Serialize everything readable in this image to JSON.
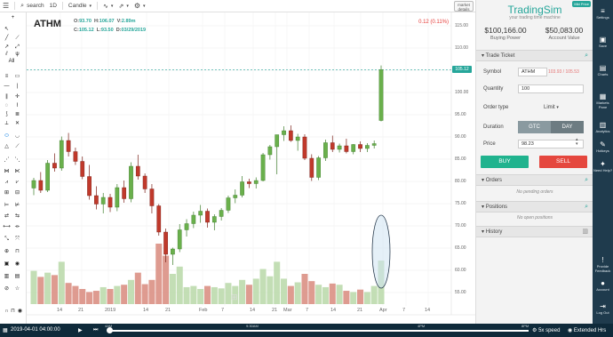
{
  "toolbar": {
    "search_label": "search",
    "interval": "1D",
    "chart_style": "Candle",
    "market_details": "market details"
  },
  "chart": {
    "symbol": "ATHM",
    "ohlc": {
      "o_label": "O:",
      "o": "93.70",
      "h_label": "H:",
      "h": "106.07",
      "v_label": "V:",
      "v": "2.89m",
      "c_label": "C:",
      "c": "105.12",
      "l_label": "L:",
      "l": "93.50",
      "d_label": "D:",
      "d": "03/29/2019"
    },
    "change": "0.12 (0.11%)",
    "last_price": "105.12",
    "y_ticks": [
      "115.00",
      "110.00",
      "105.00",
      "100.00",
      "95.00",
      "90.00",
      "85.00",
      "80.00",
      "75.00",
      "70.00",
      "65.00",
      "60.00",
      "55.00"
    ],
    "x_ticks": [
      "14",
      "21",
      "2019",
      "14",
      "21",
      "Feb",
      "7",
      "14",
      "21",
      "Mar",
      "7",
      "14",
      "21",
      "Apr",
      "7",
      "14"
    ],
    "drawing_all": "All"
  },
  "chart_data": {
    "type": "candlestick",
    "title": "ATHM",
    "ylim": [
      52,
      118
    ],
    "x_ticks": [
      "14",
      "21",
      "2019",
      "14",
      "21",
      "Feb",
      "7",
      "14",
      "21",
      "Mar",
      "7",
      "14",
      "21",
      "Apr",
      "7",
      "14"
    ],
    "candles": [
      [
        78.5,
        80.8,
        76.9,
        80.2
      ],
      [
        80.2,
        82.1,
        77.4,
        78.0
      ],
      [
        78.0,
        84.8,
        77.6,
        84.1
      ],
      [
        84.1,
        86.3,
        82.2,
        83.0
      ],
      [
        83.0,
        90.1,
        82.4,
        89.2
      ],
      [
        89.2,
        90.9,
        85.6,
        86.7
      ],
      [
        86.7,
        87.6,
        83.7,
        84.5
      ],
      [
        84.5,
        85.6,
        80.5,
        81.1
      ],
      [
        81.1,
        83.7,
        75.9,
        76.8
      ],
      [
        76.8,
        78.9,
        73.7,
        74.9
      ],
      [
        74.9,
        77.4,
        72.8,
        76.4
      ],
      [
        76.4,
        77.2,
        73.1,
        74.2
      ],
      [
        74.2,
        79.4,
        73.3,
        78.6
      ],
      [
        78.6,
        80.2,
        75.2,
        76.1
      ],
      [
        76.1,
        84.3,
        75.3,
        83.4
      ],
      [
        83.4,
        86.0,
        80.4,
        81.2
      ],
      [
        81.2,
        81.8,
        77.4,
        78.3
      ],
      [
        78.3,
        79.4,
        72.8,
        74.5
      ],
      [
        74.5,
        74.9,
        67.8,
        68.6
      ],
      [
        68.6,
        69.4,
        61.8,
        63.6
      ],
      [
        63.6,
        65.1,
        61.2,
        64.8
      ],
      [
        64.8,
        70.4,
        64.1,
        69.1
      ],
      [
        69.1,
        71.5,
        67.6,
        70.5
      ],
      [
        70.5,
        73.2,
        69.5,
        72.4
      ],
      [
        72.4,
        74.7,
        70.7,
        73.3
      ],
      [
        73.3,
        73.9,
        69.6,
        70.8
      ],
      [
        70.8,
        72.6,
        69.0,
        72.1
      ],
      [
        72.1,
        74.0,
        71.2,
        73.5
      ],
      [
        73.5,
        76.8,
        72.9,
        76.3
      ],
      [
        76.3,
        78.2,
        75.1,
        76.9
      ],
      [
        76.9,
        81.2,
        76.4,
        79.9
      ],
      [
        79.9,
        80.6,
        78.5,
        79.5
      ],
      [
        79.5,
        80.9,
        78.4,
        80.2
      ],
      [
        80.2,
        86.4,
        80.0,
        86.0
      ],
      [
        86.0,
        88.2,
        84.9,
        87.8
      ],
      [
        87.8,
        89.5,
        81.6,
        90.5
      ],
      [
        90.5,
        92.4,
        89.1,
        91.4
      ],
      [
        91.4,
        92.6,
        88.9,
        89.2
      ],
      [
        89.2,
        90.7,
        86.9,
        90.0
      ],
      [
        90.0,
        90.6,
        84.8,
        85.2
      ],
      [
        85.2,
        86.1,
        80.1,
        80.9
      ],
      [
        80.9,
        85.7,
        80.3,
        85.3
      ],
      [
        85.3,
        89.4,
        84.6,
        88.7
      ],
      [
        88.7,
        90.3,
        86.6,
        87.2
      ],
      [
        87.2,
        88.5,
        86.5,
        88.0
      ],
      [
        88.0,
        89.6,
        86.3,
        86.7
      ],
      [
        86.7,
        88.4,
        86.1,
        88.3
      ],
      [
        88.3,
        89.0,
        86.6,
        87.4
      ],
      [
        87.4,
        88.6,
        86.6,
        88.1
      ],
      [
        88.1,
        89.2,
        87.4,
        88.5
      ],
      [
        93.7,
        106.07,
        93.5,
        105.12
      ]
    ],
    "volume_relative": [
      0.55,
      0.45,
      0.52,
      0.48,
      0.7,
      0.35,
      0.3,
      0.25,
      0.2,
      0.22,
      0.28,
      0.25,
      0.3,
      0.32,
      0.4,
      0.52,
      0.33,
      0.4,
      1.0,
      0.8,
      0.5,
      0.62,
      0.28,
      0.3,
      0.25,
      0.3,
      0.28,
      0.26,
      0.35,
      0.3,
      0.4,
      0.32,
      0.42,
      0.58,
      0.46,
      0.7,
      0.42,
      0.3,
      0.36,
      0.5,
      0.38,
      0.32,
      0.28,
      0.34,
      0.32,
      0.22,
      0.2,
      0.24,
      0.2,
      0.3,
      0.72
    ]
  },
  "account": {
    "buying_power_value": "$100,166.00",
    "buying_power_label": "Buying Power",
    "account_value_value": "$50,083.00",
    "account_value_label": "Account Value"
  },
  "panel": {
    "brand": "TradingSim",
    "tagline": "your trading time machine",
    "mkt_pill": "Mkt Price",
    "trade_ticket": "Trade Ticket",
    "symbol_label": "Symbol",
    "symbol_value": "ATHM",
    "bid_ask": "103.93 / 105.53",
    "quantity_label": "Quantity",
    "quantity_value": "100",
    "order_type_label": "Order type",
    "order_type_value": "Limit",
    "duration_label": "Duration",
    "gtc": "GTC",
    "day": "DAY",
    "price_label": "Price",
    "price_value": "98.23",
    "buy": "BUY",
    "sell": "SELL",
    "orders": "Orders",
    "no_orders": "No pending orders",
    "positions": "Positions",
    "no_positions": "No open positions",
    "history": "History"
  },
  "nav": {
    "items": [
      {
        "label": "Settings",
        "icon": "≡"
      },
      {
        "label": "Save",
        "icon": "▣"
      },
      {
        "label": "Charts",
        "icon": "▤"
      },
      {
        "label": "Markets Pane",
        "icon": "▦"
      },
      {
        "label": "Analytics",
        "icon": "▥"
      },
      {
        "label": "Hotkeys",
        "icon": "✎"
      },
      {
        "label": "Need Help?",
        "icon": "✦"
      },
      {
        "label": "Provide Feedback",
        "icon": "!"
      },
      {
        "label": "Account",
        "icon": "●"
      },
      {
        "label": "Log Out",
        "icon": "⇥"
      }
    ]
  },
  "playback": {
    "datetime": "2019-04-01 04:00:00",
    "marker_4am": "4AM",
    "marker_930": "9:30AM",
    "marker_4pm": "4PM",
    "marker_8pm": "8PM",
    "speed": "5x speed",
    "extended": "Extended Hrs"
  }
}
